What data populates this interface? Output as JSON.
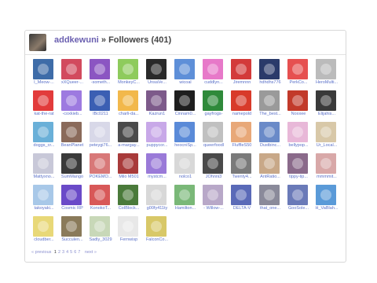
{
  "header": {
    "username": "addkewuni",
    "section": "» Followers (401)"
  },
  "followers": [
    {
      "name": "I_Meow-...",
      "color": "#3e6ca8"
    },
    {
      "name": "xXQueer-...",
      "color": "#d24a5e"
    },
    {
      "name": "-someth...",
      "color": "#8b55c2"
    },
    {
      "name": "MonkeyC...",
      "color": "#8ecb5c"
    },
    {
      "name": "UnsaVe...",
      "color": "#2a2a2a"
    },
    {
      "name": "wicoal",
      "color": "#5e8fd8"
    },
    {
      "name": "cuddlyn...",
      "color": "#e779c9"
    },
    {
      "name": "Jiremnnn",
      "color": "#d33a3a"
    },
    {
      "name": "hdhdhs776",
      "color": "#2a3a6a"
    },
    {
      "name": "PerkCo...",
      "color": "#e65050"
    },
    {
      "name": "HeroMulti...",
      "color": "#bbbbbb"
    },
    {
      "name": "kat-the-rat",
      "color": "#e23b3b"
    },
    {
      "name": "-coxkieb...",
      "color": "#9d7ae0"
    },
    {
      "name": "lBc0211",
      "color": "#3b5fb3"
    },
    {
      "name": "charli-da...",
      "color": "#f2b84b"
    },
    {
      "name": "Kazrun1",
      "color": "#7d5a8a"
    },
    {
      "name": "Cinnam0...",
      "color": "#1e1e1e"
    },
    {
      "name": "gayfrogs-",
      "color": "#2f8a3a"
    },
    {
      "name": "namepold",
      "color": "#d83a2a"
    },
    {
      "name": "The_best...",
      "color": "#9a9a9a"
    },
    {
      "name": "Noxxee",
      "color": "#c23a2a"
    },
    {
      "name": "Elijahis...",
      "color": "#3a3a3a"
    },
    {
      "name": "doggs_cr...",
      "color": "#6ab0d8"
    },
    {
      "name": "BeanPlanet",
      "color": "#8a6a5a"
    },
    {
      "name": "peteygi76...",
      "color": "#d8d8e8"
    },
    {
      "name": "a-margay...",
      "color": "#4a4a4a"
    },
    {
      "name": "puppycor...",
      "color": "#c8a8e8"
    },
    {
      "name": "heocniSp...",
      "color": "#5a8ad8"
    },
    {
      "name": "queerfoodl",
      "color": "#c0c0c0"
    },
    {
      "name": "FluffleS50",
      "color": "#e8a878"
    },
    {
      "name": "Dustbinc...",
      "color": "#6a8ac8"
    },
    {
      "name": "bellypop...",
      "color": "#e8b8d8"
    },
    {
      "name": "Ur_Local...",
      "color": "#d8c8a8"
    },
    {
      "name": "Mattyxno...",
      "color": "#c8c8d8"
    },
    {
      "name": "SumMango",
      "color": "#3a3a3a"
    },
    {
      "name": "POKEMO...",
      "color": "#d87878"
    },
    {
      "name": "Milo M501",
      "color": "#a83a3a"
    },
    {
      "name": "mystcm...",
      "color": "#9a7ad8"
    },
    {
      "name": "nolco1",
      "color": "#d8d8d8"
    },
    {
      "name": "JOhnni3",
      "color": "#4a4a4a"
    },
    {
      "name": "Twenty4...",
      "color": "#7a7a7a"
    },
    {
      "name": "AntRatio...",
      "color": "#c8a888"
    },
    {
      "name": "tippy-tip...",
      "color": "#8a6a8a"
    },
    {
      "name": "mmmmit...",
      "color": "#d8a8a8"
    },
    {
      "name": "takoyaki...",
      "color": "#a8c8e8"
    },
    {
      "name": "Cosmic RP",
      "color": "#6a4ac8"
    },
    {
      "name": "KonokoT...",
      "color": "#d85858"
    },
    {
      "name": "CoIBlock...",
      "color": "#4a7a3a"
    },
    {
      "name": "g00fy411ty",
      "color": "#d8d8d8"
    },
    {
      "name": "Hamilton...",
      "color": "#7ab878"
    },
    {
      "name": "- Willow-...",
      "color": "#b8a8c8"
    },
    {
      "name": "DELTA-V",
      "color": "#5a6ab8"
    },
    {
      "name": "that_one...",
      "color": "#8a8a9a"
    },
    {
      "name": "GooSole...",
      "color": "#6a7ab8"
    },
    {
      "name": "H_VaBlah...",
      "color": "#5a9ad8"
    },
    {
      "name": "cloudber...",
      "color": "#e8d878"
    },
    {
      "name": "Succulen...",
      "color": "#8a7a5a"
    },
    {
      "name": "Sadly_3029",
      "color": "#c8d8b8"
    },
    {
      "name": "Fernwisp",
      "color": "#e8e8e8"
    },
    {
      "name": "FalconCo...",
      "color": "#d8c868"
    }
  ],
  "pagination": {
    "previous": "« previous",
    "pages": [
      "1",
      "2",
      "3",
      "4",
      "5",
      "6",
      "7"
    ],
    "current": "1",
    "next": "next »"
  }
}
